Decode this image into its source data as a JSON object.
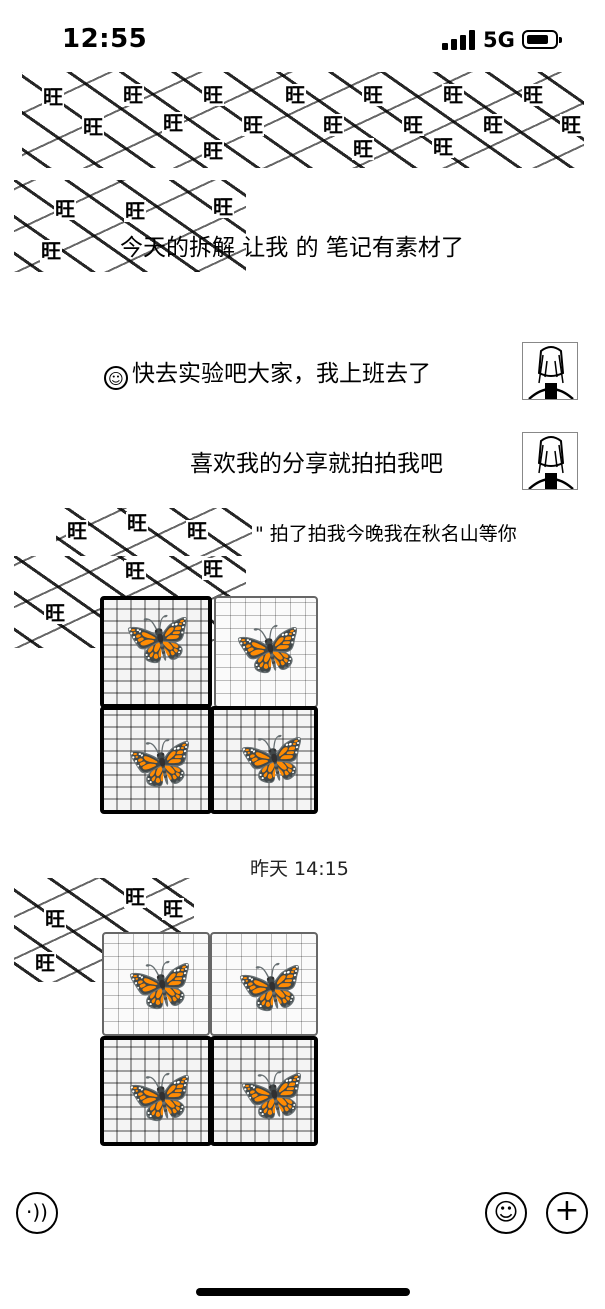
{
  "status_bar": {
    "time": "12:55",
    "network": "5G",
    "signal_icon": "cellular-signal-icon",
    "battery_icon": "battery-icon"
  },
  "sticker_char": "旺",
  "messages": [
    {
      "id": "msg1",
      "side": "left",
      "text": "今天的拆解 让我 的 笔记有素材了"
    },
    {
      "id": "msg2",
      "side": "right",
      "emoji": "☺",
      "text": "快去实验吧大家，我上班去了"
    },
    {
      "id": "msg3",
      "side": "right",
      "text": "喜欢我的分享就拍拍我吧"
    },
    {
      "id": "msg4",
      "side": "left",
      "text": "\" 拍了拍我今晚我在秋名山等你"
    }
  ],
  "date_divider": "昨天 14:15",
  "toolbar": {
    "voice_icon": "voice-icon",
    "emoji_icon": "emoji-icon",
    "plus_icon": "plus-icon",
    "voice_glyph": "·))",
    "emoji_glyph": "☺",
    "plus_glyph": "+"
  },
  "image_glyph": "🦋"
}
